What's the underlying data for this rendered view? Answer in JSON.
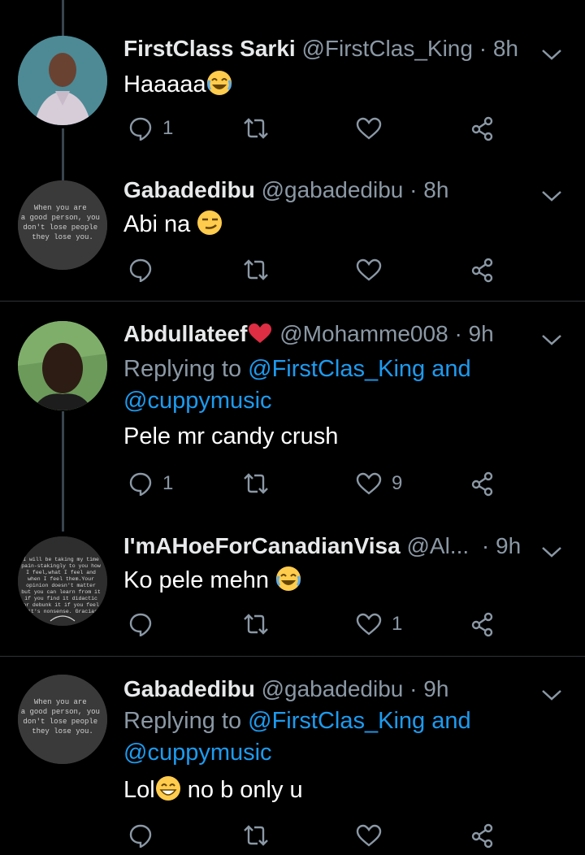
{
  "colors": {
    "background": "#000000",
    "text": "#ffffff",
    "secondary": "#8b98a5",
    "link": "#1d9bf0",
    "heart": "#e0245e"
  },
  "tweets": [
    {
      "name": "FirstClass Sarki",
      "handle": "@FirstClas_King",
      "time": "8h",
      "text": "Haaaaa",
      "emoji": "joy",
      "replies": "1",
      "likes": ""
    },
    {
      "name": "Gabadedibu",
      "handle": "@gabadedibu",
      "time": "8h",
      "text": "Abi na",
      "emoji": "smirk",
      "replies": "",
      "likes": "",
      "avatar_text": [
        "When you are",
        "a good person, you",
        "don't lose people",
        "they lose you."
      ]
    },
    {
      "name": "Abdullateef",
      "handle": "@Mohamme008",
      "time": "9h",
      "reply_prefix": "Replying to",
      "reply_to_1": "@FirstClas_King",
      "reply_and": "and",
      "reply_to_2": "@cuppymusic",
      "text": "Pele mr candy crush",
      "replies": "1",
      "likes": "9"
    },
    {
      "name": "I'mAHoeForCanadianVisa",
      "handle": "@Al...",
      "time": "9h",
      "text": "Ko pele mehn",
      "emoji": "joy",
      "replies": "",
      "likes": "1",
      "avatar_text": [
        "I will be taking my time",
        "pain-stakingly to you how",
        "I feel,what I feel and",
        "when I feel them.Your",
        "opinion doesn't matter",
        "but you can learn from it",
        "if you find it didactic",
        "or debunk it if you feel",
        "it's nonsense. Gracias"
      ]
    },
    {
      "name": "Gabadedibu",
      "handle": "@gabadedibu",
      "time": "9h",
      "reply_prefix": "Replying to",
      "reply_to_1": "@FirstClas_King",
      "reply_and": "and",
      "reply_to_2": "@cuppymusic",
      "text_a": "Lol",
      "text_b": "no b only u",
      "emoji": "grin",
      "replies": "",
      "likes": "",
      "avatar_text": [
        "When you are",
        "a good person, you",
        "don't lose people",
        "they lose you."
      ]
    }
  ]
}
